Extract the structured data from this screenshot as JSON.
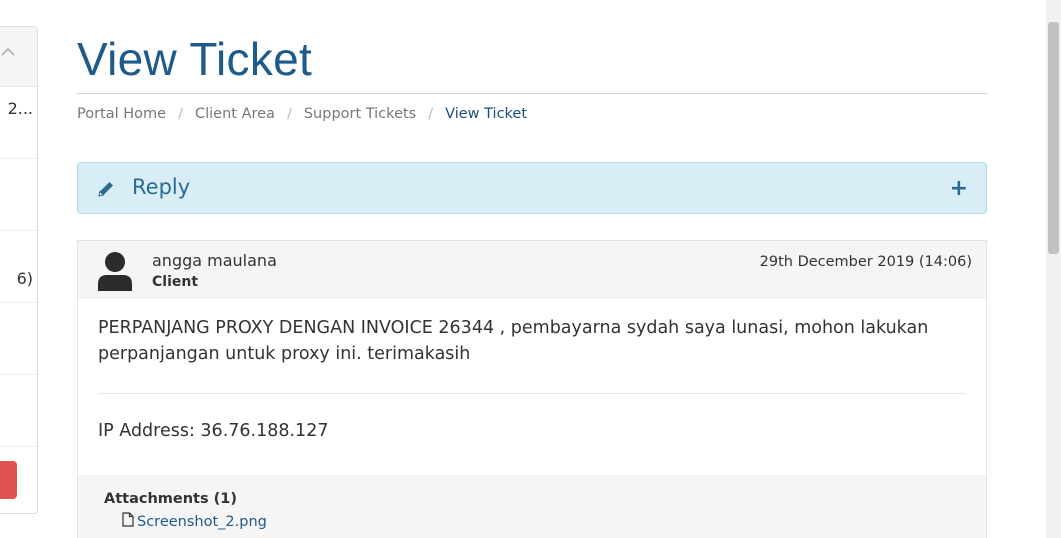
{
  "sidebar": {
    "fragments": [
      "2...",
      "6)"
    ]
  },
  "page": {
    "title": "View Ticket"
  },
  "breadcrumb": {
    "items": [
      "Portal Home",
      "Client Area",
      "Support Tickets",
      "View Ticket"
    ]
  },
  "reply": {
    "label": "Reply",
    "expand_symbol": "+"
  },
  "ticket": {
    "author": "angga maulana",
    "role": "Client",
    "date": "29th December 2019 (14:06)",
    "message": "PERPANJANG PROXY DENGAN INVOICE 26344 , pembayarna sydah saya lunasi, mohon lakukan perpanjangan untuk proxy ini. terimakasih",
    "ip_address": "IP Address: 36.76.188.127",
    "attachments_title": "Attachments (1)",
    "attachment_file": "Screenshot_2.png"
  },
  "colors": {
    "title": "#1d5b8c",
    "reply_bg": "#d8edf6",
    "link": "#1d5b8c",
    "sidebar_button": "#e05252"
  }
}
